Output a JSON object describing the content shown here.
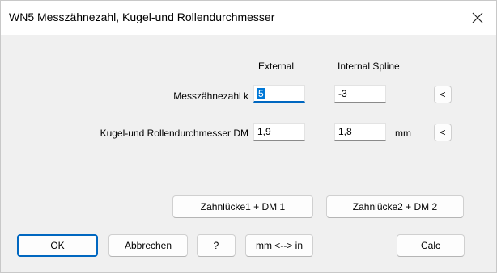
{
  "window": {
    "title": "WN5  Messzähnezahl, Kugel-und Rollendurchmesser",
    "close_glyph": "✕"
  },
  "columns": {
    "external": "External",
    "internal": "Internal Spline"
  },
  "rows": [
    {
      "label": "Messzähnezahl k",
      "external_value": "5",
      "internal_value": "-3",
      "unit": "",
      "arrow_label": "<"
    },
    {
      "label": "Kugel-und Rollendurchmesser DM",
      "external_value": "1,9",
      "internal_value": "1,8",
      "unit": "mm",
      "arrow_label": "<"
    }
  ],
  "gap_buttons": {
    "gap1": "Zahnlücke1 + DM 1",
    "gap2": "Zahnlücke2 + DM 2"
  },
  "footer": {
    "ok": "OK",
    "cancel": "Abbrechen",
    "help": "?",
    "units": "mm <--> in",
    "calc": "Calc"
  },
  "colors": {
    "accent": "#0067c0",
    "selection": "#0078d7"
  }
}
